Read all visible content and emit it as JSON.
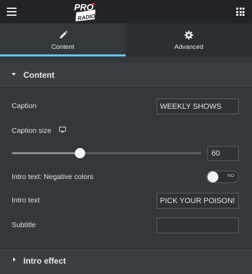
{
  "app": {
    "logo_text_line1": "PRO",
    "logo_text_line2": "RADIO"
  },
  "tabs": [
    {
      "label": "Content",
      "icon": "pencil-icon",
      "active": true
    },
    {
      "label": "Advanced",
      "icon": "gear-icon",
      "active": false
    }
  ],
  "section": {
    "title": "Content",
    "expanded": true
  },
  "fields": {
    "caption": {
      "label": "Caption",
      "value": "WEEKLY SHOWS"
    },
    "caption_size": {
      "label": "Caption size",
      "value": "60",
      "slider_fraction": 0.36
    },
    "negative_colors": {
      "label": "Intro text: Negative colors",
      "state_text": "NO"
    },
    "intro_text": {
      "label": "Intro text",
      "value": "PICK YOUR POISON!"
    },
    "subtitle": {
      "label": "Subtitle",
      "value": ""
    }
  },
  "collapsed_section": {
    "title": "Intro effect",
    "expanded": false
  },
  "colors": {
    "accent": "#5fc7ee",
    "logo_red": "#e52e2e"
  }
}
